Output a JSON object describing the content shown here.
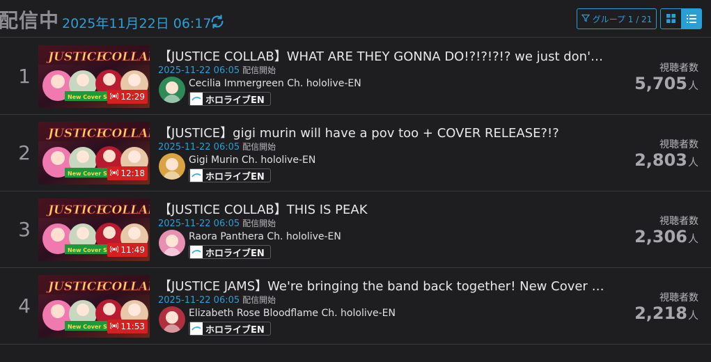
{
  "header": {
    "title": "配信中",
    "timestamp": "2025年11月22日 06:17",
    "group_label": "グループ 1 / 21"
  },
  "colors": {
    "accent": "#2a9fd6",
    "live_badge": "#d42020",
    "background": "#1e1e20"
  },
  "icons": {
    "refresh": "refresh-icon",
    "filter": "filter-icon",
    "grid_view": "grid-view-icon",
    "list_view": "list-view-icon",
    "live": "live-broadcast-icon"
  },
  "streams": [
    {
      "rank": "1",
      "title": "【JUSTICE COLLAB】WHAT ARE THEY GONNA DO!?!?!?!? we just don't know!",
      "started": "2025-11-22 06:05",
      "started_suffix": "配信開始",
      "channel": "Cecilia Immergreen Ch. hololive-EN",
      "org": "ホロライブEN",
      "duration": "12:29",
      "viewers_label": "視聴者数",
      "viewers": "5,705",
      "viewers_unit": "人",
      "thumb_banner": "New Cover Son",
      "avatar_color": "#2e8b57"
    },
    {
      "rank": "2",
      "title": "【JUSTICE】gigi murin will have a pov too + COVER RELEASE?!?",
      "started": "2025-11-22 06:05",
      "started_suffix": "配信開始",
      "channel": "Gigi Murin Ch. hololive-EN",
      "org": "ホロライブEN",
      "duration": "12:18",
      "viewers_label": "視聴者数",
      "viewers": "2,803",
      "viewers_unit": "人",
      "thumb_banner": "New Cover Son",
      "avatar_color": "#d9a441"
    },
    {
      "rank": "3",
      "title": "【JUSTICE COLLAB】THIS IS PEAK",
      "started": "2025-11-22 06:05",
      "started_suffix": "配信開始",
      "channel": "Raora Panthera Ch. hololive-EN",
      "org": "ホロライブEN",
      "duration": "11:49",
      "viewers_label": "視聴者数",
      "viewers": "2,306",
      "viewers_unit": "人",
      "thumb_banner": "New Cover Son",
      "avatar_color": "#e88fb4"
    },
    {
      "rank": "4",
      "title": "【JUSTICE JAMS】We're bringing the band back together! New Cover SON…",
      "started": "2025-11-22 06:05",
      "started_suffix": "配信開始",
      "channel": "Elizabeth Rose Bloodflame Ch. hololive-EN",
      "org": "ホロライブEN",
      "duration": "11:53",
      "viewers_label": "視聴者数",
      "viewers": "2,218",
      "viewers_unit": "人",
      "thumb_banner": "New Cover Son",
      "avatar_color": "#b03040"
    }
  ]
}
